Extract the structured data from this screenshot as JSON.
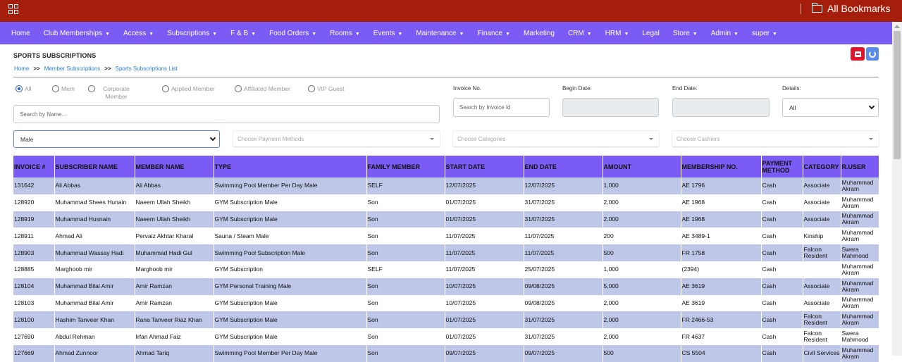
{
  "bookmarks": {
    "label": "All Bookmarks"
  },
  "nav": [
    {
      "label": "Home",
      "caret": false
    },
    {
      "label": "Club Memberships",
      "caret": true
    },
    {
      "label": "Access",
      "caret": true
    },
    {
      "label": "Subscriptions",
      "caret": true
    },
    {
      "label": "F & B",
      "caret": true
    },
    {
      "label": "Food Orders",
      "caret": true
    },
    {
      "label": "Rooms",
      "caret": true
    },
    {
      "label": "Events",
      "caret": true
    },
    {
      "label": "Maintenance",
      "caret": true
    },
    {
      "label": "Finance",
      "caret": true
    },
    {
      "label": "Marketing",
      "caret": false
    },
    {
      "label": "CRM",
      "caret": true
    },
    {
      "label": "HRM",
      "caret": true
    },
    {
      "label": "Legal",
      "caret": false
    },
    {
      "label": "Store",
      "caret": true
    },
    {
      "label": "Admin",
      "caret": true
    },
    {
      "label": "super",
      "caret": true
    }
  ],
  "page": {
    "title": "SPORTS SUBSCRIPTIONS",
    "breadcrumb": [
      "Home",
      "Member Subscriptions",
      "Sports Subscriptions List"
    ],
    "breadcrumb_sep": ">>"
  },
  "filters": {
    "radios": [
      {
        "label": "All",
        "selected": true
      },
      {
        "label": "Mem",
        "selected": false
      },
      {
        "label": "Corporate Member",
        "selected": false
      },
      {
        "label": "Applied Member",
        "selected": false
      },
      {
        "label": "Affiliated Member",
        "selected": false
      },
      {
        "label": "VIP Guest",
        "selected": false
      }
    ],
    "search_placeholder": "Search by Name...",
    "invoice_label": "Invoice No.",
    "invoice_placeholder": "Search by Invoice Id",
    "begin_label": "Begin Date:",
    "end_label": "End Date:",
    "details_label": "Details:",
    "details_value": "All",
    "gender_value": "Male",
    "payment_placeholder": "Choose Payment Methods",
    "categories_placeholder": "Choose Categories",
    "cashiers_placeholder": "Choose Cashiers"
  },
  "table": {
    "columns": [
      "INVOICE #",
      "SUBSCRIBER NAME",
      "MEMBER NAME",
      "TYPE",
      "FAMILY MEMBER",
      "START DATE",
      "END DATE",
      "AMOUNT",
      "MEMBERSHIP NO.",
      "PAYMENT METHOD",
      "CATEGORY",
      "R.USER"
    ],
    "rows": [
      [
        "131642",
        "Ali Abbas",
        "Ali Abbas",
        "Swimming Pool Member Per Day Male",
        "SELF",
        "12/07/2025",
        "12/07/2025",
        "1,000",
        "AE 1796",
        "Cash",
        "Associate",
        "Muhammad Akram"
      ],
      [
        "128920",
        "Muhammad Shees Hunain",
        "Naeem Ullah Sheikh",
        "GYM Subscription Male",
        "Son",
        "01/07/2025",
        "31/07/2025",
        "2,000",
        "AE 1968",
        "Cash",
        "Associate",
        "Muhammad Akram"
      ],
      [
        "128919",
        "Muhammad Husnain",
        "Naeem Ullah Sheikh",
        "GYM Subscription Male",
        "Son",
        "01/07/2025",
        "31/07/2025",
        "2,000",
        "AE 1968",
        "Cash",
        "Associate",
        "Muhammad Akram"
      ],
      [
        "128911",
        "Ahmad Ali",
        "Pervaiz Akhtar Kharal",
        "Sauna / Steam Male",
        "Son",
        "11/07/2025",
        "11/07/2025",
        "200",
        "AE 3489-1",
        "Cash",
        "Kinship",
        "Muhammad Akram"
      ],
      [
        "128903",
        "Muhammad Wassay Hadi",
        "Muhammad Hadi Gul",
        "Swimming Pool Subscription Male",
        "Son",
        "11/07/2025",
        "11/07/2025",
        "500",
        "FR 1758",
        "Cash",
        "Falcon Resident",
        "Swera Mahmood"
      ],
      [
        "128885",
        "Marghoob mir",
        "Marghoob mir",
        "GYM Subscription",
        "SELF",
        "11/07/2025",
        "25/07/2025",
        "1,000",
        "(2394)",
        "Cash",
        "",
        "Muhammad Akram"
      ],
      [
        "128104",
        "Muhammad Bilal Amir",
        "Amir Ramzan",
        "GYM Personal Training Male",
        "Son",
        "10/07/2025",
        "09/08/2025",
        "5,000",
        "AE 3619",
        "Cash",
        "Associate",
        "Muhammad Akram"
      ],
      [
        "128103",
        "Muhammad Bilal Amir",
        "Amir Ramzan",
        "GYM Subscription Male",
        "Son",
        "10/07/2025",
        "09/08/2025",
        "2,000",
        "AE 3619",
        "Cash",
        "Associate",
        "Muhammad Akram"
      ],
      [
        "128100",
        "Hashim Tanveer Khan",
        "Rana Tanveer Riaz Khan",
        "GYM Subscription Male",
        "Son",
        "01/07/2025",
        "31/07/2025",
        "2,000",
        "FR 2466-53",
        "Cash",
        "Falcon Resident",
        "Muhammad Akram"
      ],
      [
        "127690",
        "Abdul Rehman",
        "Irfan Ahmad Faiz",
        "GYM Subscription Male",
        "Son",
        "01/07/2025",
        "31/07/2025",
        "2,000",
        "FR 4637",
        "Cash",
        "Falcon Resident",
        "Swera Mahmood"
      ],
      [
        "127669",
        "Ahmad Zunnoor",
        "Ahmad Tariq",
        "Swimming Pool Member Per Day Male",
        "Son",
        "09/07/2025",
        "09/07/2025",
        "500",
        "CS 5504",
        "Cash",
        "Civil Services",
        "Muhammad Akram"
      ]
    ]
  }
}
